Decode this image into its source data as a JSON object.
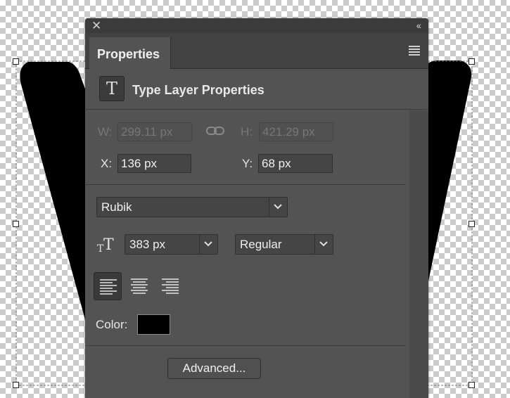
{
  "window": {
    "close_glyph": "✕",
    "collapse_glyph": "‹‹"
  },
  "tabs": [
    {
      "label": "Properties",
      "active": true
    }
  ],
  "panel": {
    "title": "Type Layer Properties",
    "type_icon_glyph": "T"
  },
  "transform": {
    "w_label": "W:",
    "w_value": "299.11 px",
    "h_label": "H:",
    "h_value": "421.29 px",
    "x_label": "X:",
    "x_value": "136 px",
    "y_label": "Y:",
    "y_value": "68 px"
  },
  "character": {
    "font_family": "Rubik",
    "font_size": "383 px",
    "font_style": "Regular",
    "font_size_icon_glyph": "TT"
  },
  "paragraph": {
    "alignment": "left",
    "options": [
      "left",
      "center",
      "right"
    ]
  },
  "color": {
    "label": "Color:",
    "value": "#000000"
  },
  "advanced_button": "Advanced...",
  "canvas": {
    "shape_color": "#000000",
    "background": "transparency-checkerboard"
  }
}
